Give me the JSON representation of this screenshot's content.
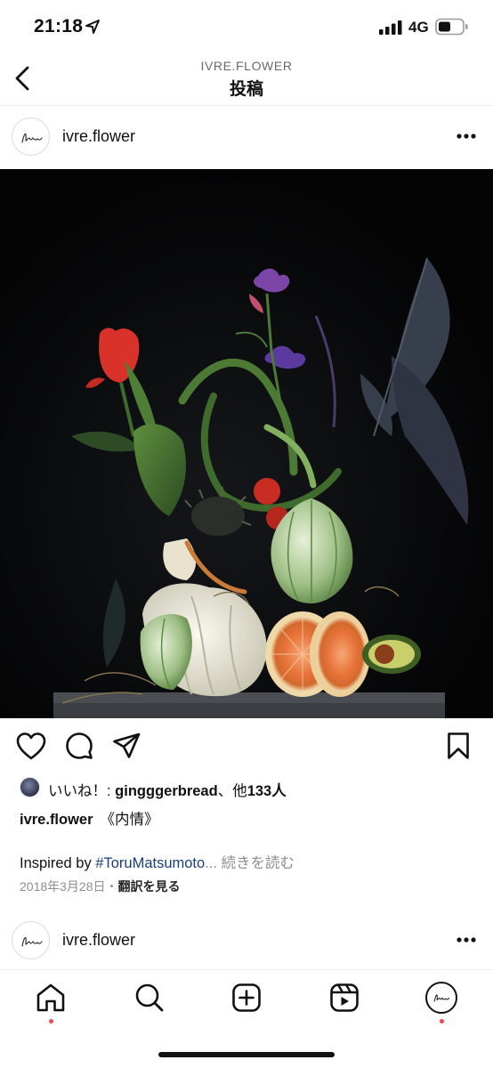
{
  "status_bar": {
    "time": "21:18",
    "network": "4G",
    "icons": [
      "location-arrow-icon",
      "signal-icon",
      "battery-icon"
    ]
  },
  "nav": {
    "account": "IVRE.FLOWER",
    "title": "投稿",
    "back_icon": "chevron-left-icon"
  },
  "post": {
    "username": "ivre.flower",
    "likes": {
      "prefix": "いいね！: ",
      "user": "gingggerbread",
      "middle": "、他",
      "count": "133人"
    },
    "caption_user": "ivre.flower",
    "caption_title": "《内情》",
    "caption_body": {
      "prefix": "Inspired by ",
      "hashtag": "#ToruMatsumoto",
      "ellipsis": "...",
      "more": " 続きを読む"
    },
    "date": "2018年3月28日",
    "separator": "・",
    "translate": "翻訳を見る"
  },
  "next_post": {
    "username": "ivre.flower"
  },
  "actions": [
    "heart-icon",
    "comment-icon",
    "share-icon",
    "bookmark-icon"
  ],
  "tab_bar": [
    "home-icon",
    "search-icon",
    "new-post-icon",
    "reels-icon",
    "profile-avatar"
  ],
  "colors": {
    "hashtag": "#1d3e78",
    "secondary_text": "#8e8e8e",
    "notification_dot": "#ed4956"
  }
}
